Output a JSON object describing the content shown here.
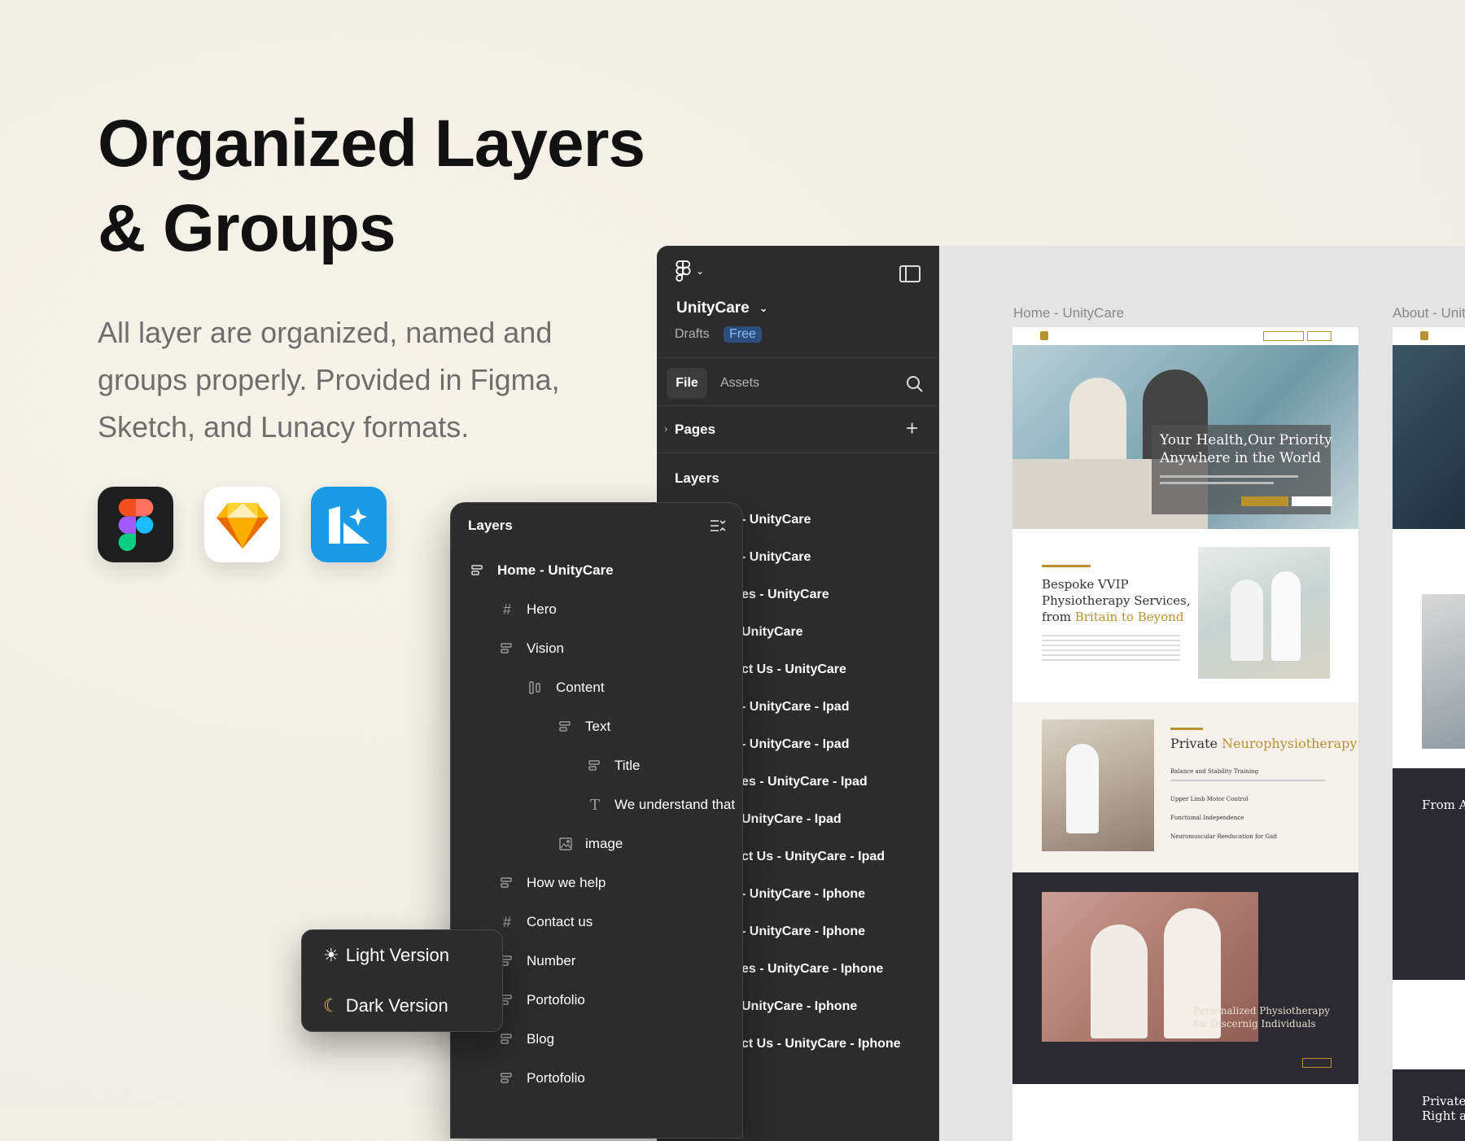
{
  "hero": {
    "title_line1": "Organized Layers",
    "title_line2": "& Groups",
    "description_line1": "All layer are organized, named and",
    "description_line2": "groups properly. Provided in Figma,",
    "description_line3": "Sketch, and Lunacy formats."
  },
  "apps": [
    "figma-icon",
    "sketch-icon",
    "lunacy-icon"
  ],
  "figma": {
    "project_name": "UnityCare",
    "location": "Drafts",
    "plan_badge": "Free",
    "tabs": {
      "file": "File",
      "assets": "Assets"
    },
    "pages_label": "Pages",
    "layers_label": "Layers",
    "right_layers": [
      "- UnityCare",
      "- UnityCare",
      "es - UnityCare",
      "UnityCare",
      "ct Us - UnityCare",
      "- UnityCare - Ipad",
      "- UnityCare - Ipad",
      "es - UnityCare - Ipad",
      "UnityCare - Ipad",
      "ct Us - UnityCare - Ipad",
      "- UnityCare - Iphone",
      "- UnityCare - Iphone",
      "es - UnityCare - Iphone",
      "UnityCare - Iphone",
      "ct Us - UnityCare - Iphone"
    ]
  },
  "layers_panel": {
    "title": "Layers",
    "items": {
      "home": "Home - UnityCare",
      "hero": "Hero",
      "vision": "Vision",
      "content": "Content",
      "text": "Text",
      "title": "Title",
      "we_understand": "We understand that",
      "image": "image",
      "how_we_help": "How we help",
      "contact_us": "Contact us",
      "number": "Number",
      "portofolio1": "Portofolio",
      "blog": "Blog",
      "portofolio2": "Portofolio"
    }
  },
  "versions": {
    "light": "Light Version",
    "dark": "Dark Version"
  },
  "canvas": {
    "frame1_label": "Home - UnityCare",
    "frame2_label": "About - Unit",
    "hero_heading_line1": "Your Health,Our Priority",
    "hero_heading_line2": "Anywhere in the World",
    "vision_heading_line1": "Bespoke VVIP",
    "vision_heading_line2": "Physiotherapy Services,",
    "vision_heading_line3_prefix": "from ",
    "vision_heading_line3_accent": "Britain to Beyond",
    "help_heading_prefix": "Private ",
    "help_heading_accent": "Neurophysiotherapy",
    "help_items": [
      "Balance and Stability Training",
      "Upper Limb Motor Control",
      "Functional Independence",
      "Neuromuscular Reeducation for Gait"
    ],
    "dark_caption_line1": "Personalized Physiotherapy",
    "dark_caption_line2": "for Discernig Individuals",
    "right_frame_text1": "From As",
    "right_frame_text2": "Private",
    "right_frame_text3": "Right at"
  },
  "colors": {
    "accent_gold": "#b8922e",
    "figma_panel": "#2c2c2c",
    "lunacy_blue": "#1b9be6"
  }
}
